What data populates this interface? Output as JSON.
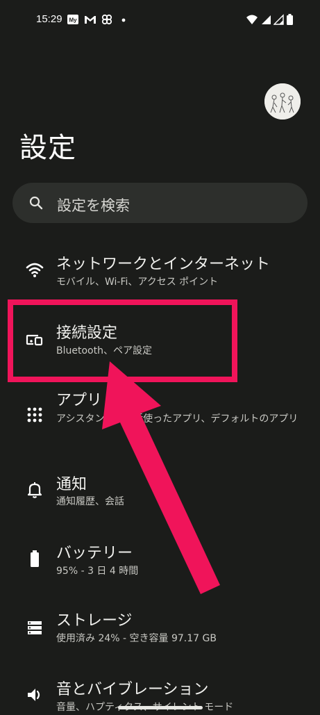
{
  "status_bar": {
    "time": "15:29",
    "notification_icons": [
      "my-app-icon",
      "gmail-icon",
      "pinwheel-icon",
      "dot-icon"
    ],
    "system_icons": [
      "wifi-icon",
      "signal-icon",
      "signal-icon-2",
      "battery-icon"
    ]
  },
  "page": {
    "title": "設定"
  },
  "search": {
    "placeholder": "設定を検索"
  },
  "settings_items": [
    {
      "title": "ネットワークとインターネット",
      "subtitle": "モバイル、Wi-Fi、アクセス ポイント",
      "icon": "wifi-icon"
    },
    {
      "title": "接続設定",
      "subtitle": "Bluetooth、ペア設定",
      "icon": "connected-devices-icon"
    },
    {
      "title": "アプリ",
      "subtitle": "アシスタント、最近使ったアプリ、デフォルトのアプリ",
      "icon": "apps-grid-icon"
    },
    {
      "title": "通知",
      "subtitle": "通知履歴、会話",
      "icon": "bell-icon"
    },
    {
      "title": "バッテリー",
      "subtitle": "95% - 3 日 4 時間",
      "icon": "battery-icon"
    },
    {
      "title": "ストレージ",
      "subtitle": "使用済み 24% - 空き容量 97.17 GB",
      "icon": "storage-icon"
    },
    {
      "title": "音とバイブレーション",
      "subtitle": "音量、ハプティクス、サイレント モード",
      "icon": "volume-icon"
    }
  ],
  "annotation": {
    "highlight_color": "#f0145a"
  },
  "colors": {
    "background": "#1b1c1a",
    "search_bg": "#2d2f2c",
    "accent": "#f0145a"
  }
}
